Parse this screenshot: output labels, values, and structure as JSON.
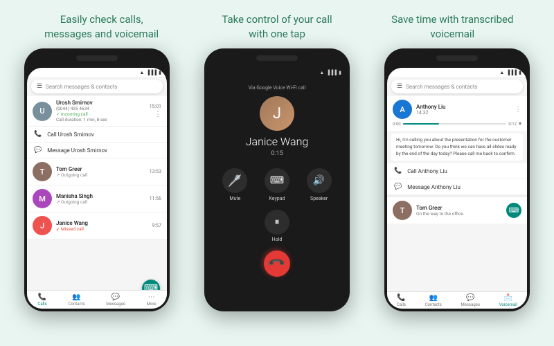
{
  "background_color": "#e8f5f0",
  "header": {
    "col1": "Easily check calls,\nmessages and voicemail",
    "col2": "Take control of your call\nwith one tap",
    "col3": "Save time with transcribed\nvoicemail"
  },
  "phone1": {
    "search_placeholder": "Search messages & contacts",
    "contacts": [
      {
        "name": "Urosh Smirnov",
        "number": "(0044) 435 4634",
        "call_type": "Incoming call",
        "time": "15:01",
        "duration": "Call duration: 1 min, 8 sec",
        "avatar_color": "#78909c",
        "avatar_letter": "U"
      },
      {
        "name": "Tom Greer",
        "call_type": "Outgoing call",
        "time": "13:53",
        "avatar_color": "#8d6e63",
        "avatar_letter": "T"
      },
      {
        "name": "Manisha Singh",
        "call_type": "Outgoing call",
        "time": "11:56",
        "avatar_color": "#ab47bc",
        "avatar_letter": "M"
      },
      {
        "name": "Janice Wang",
        "call_type": "Missed call",
        "time": "9:57",
        "avatar_color": "#ef5350",
        "avatar_letter": "J"
      }
    ],
    "actions": [
      "Call Urosh Smirnov",
      "Message Urosh Smirnov"
    ],
    "nav": [
      "Calls",
      "Contacts",
      "Messages",
      "More"
    ],
    "active_nav": "Calls"
  },
  "phone2": {
    "via_text": "Via Google Voice Wi-Fi call",
    "caller_name": "Janice Wang",
    "duration": "0:15",
    "buttons": [
      "Mute",
      "Keypad",
      "Speaker"
    ],
    "hold_label": "Hold",
    "mute_icon": "🎤",
    "keypad_icon": "⌨",
    "speaker_icon": "🔊",
    "hold_icon": "⏸",
    "end_icon": "📞"
  },
  "phone3": {
    "search_placeholder": "Search messages & contacts",
    "contact": {
      "name": "Anthony Liu",
      "time": "14:32",
      "avatar_color": "#1976d2",
      "avatar_letter": "A"
    },
    "audio_start": "0:00",
    "audio_end": "0:12",
    "transcript": "Hi, I'm calling you about the presentation for the customer meeting tomorrow. Do you think we can have all slides ready by the end of the day today? Please call me back to confirm.",
    "actions": [
      "Call Anthony Liu",
      "Message Anthony Liu"
    ],
    "tom": {
      "name": "Tom Greer",
      "status": "On the way to the office.",
      "avatar_color": "#8d6e63",
      "avatar_letter": "T"
    },
    "nav": [
      "Calls",
      "Contacts",
      "Messages",
      "Voicemail"
    ],
    "active_nav": "Voicemail"
  },
  "icons": {
    "hamburger": "☰",
    "search": "🔍",
    "phone": "📞",
    "message": "💬",
    "more": "⋮",
    "calls": "📞",
    "contacts": "👥",
    "messages": "💬",
    "voicemail": "📩",
    "incoming": "↙",
    "outgoing": "↗",
    "missed": "↙",
    "pause": "⏸",
    "dots": "⋮",
    "grid": "⋮⋮⋮"
  }
}
